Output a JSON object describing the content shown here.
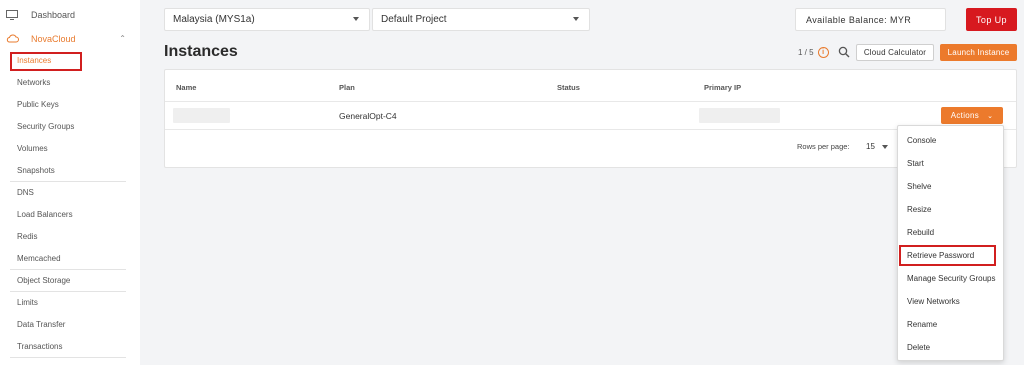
{
  "sidebar": {
    "dashboard_label": "Dashboard",
    "group_label": "NovaCloud",
    "items": [
      {
        "label": "Instances"
      },
      {
        "label": "Networks"
      },
      {
        "label": "Public Keys"
      },
      {
        "label": "Security Groups"
      },
      {
        "label": "Volumes"
      },
      {
        "label": "Snapshots"
      },
      {
        "label": "DNS"
      },
      {
        "label": "Load Balancers"
      },
      {
        "label": "Redis"
      },
      {
        "label": "Memcached"
      },
      {
        "label": "Object Storage"
      },
      {
        "label": "Limits"
      },
      {
        "label": "Data Transfer"
      },
      {
        "label": "Transactions"
      }
    ],
    "active_item": "Instances"
  },
  "topbar": {
    "region": "Malaysia (MYS1a)",
    "project": "Default Project",
    "balance_label": "Available Balance: MYR",
    "topup_label": "Top Up"
  },
  "page": {
    "title": "Instances",
    "pager": "1 / 5",
    "info_glyph": "i",
    "calculator_label": "Cloud Calculator",
    "launch_label": "Launch Instance"
  },
  "table": {
    "columns": [
      "Name",
      "Plan",
      "Status",
      "Primary IP"
    ],
    "rows": [
      {
        "name": "",
        "plan": "GeneralOpt-C4",
        "status": "",
        "primary_ip": ""
      }
    ],
    "actions_label": "Actions",
    "rows_per_page_label": "Rows per page:",
    "rows_per_page_value": "15"
  },
  "actions_menu": {
    "items": [
      {
        "label": "Console"
      },
      {
        "label": "Start"
      },
      {
        "label": "Shelve"
      },
      {
        "label": "Resize"
      },
      {
        "label": "Rebuild"
      },
      {
        "label": "Retrieve Password"
      },
      {
        "label": "Manage Security Groups"
      },
      {
        "label": "View Networks"
      },
      {
        "label": "Rename"
      },
      {
        "label": "Delete"
      }
    ],
    "highlighted": "Retrieve Password"
  },
  "colors": {
    "accent": "#ec7a2c",
    "danger": "#d7191f",
    "highlight_box": "#d11f1f"
  }
}
